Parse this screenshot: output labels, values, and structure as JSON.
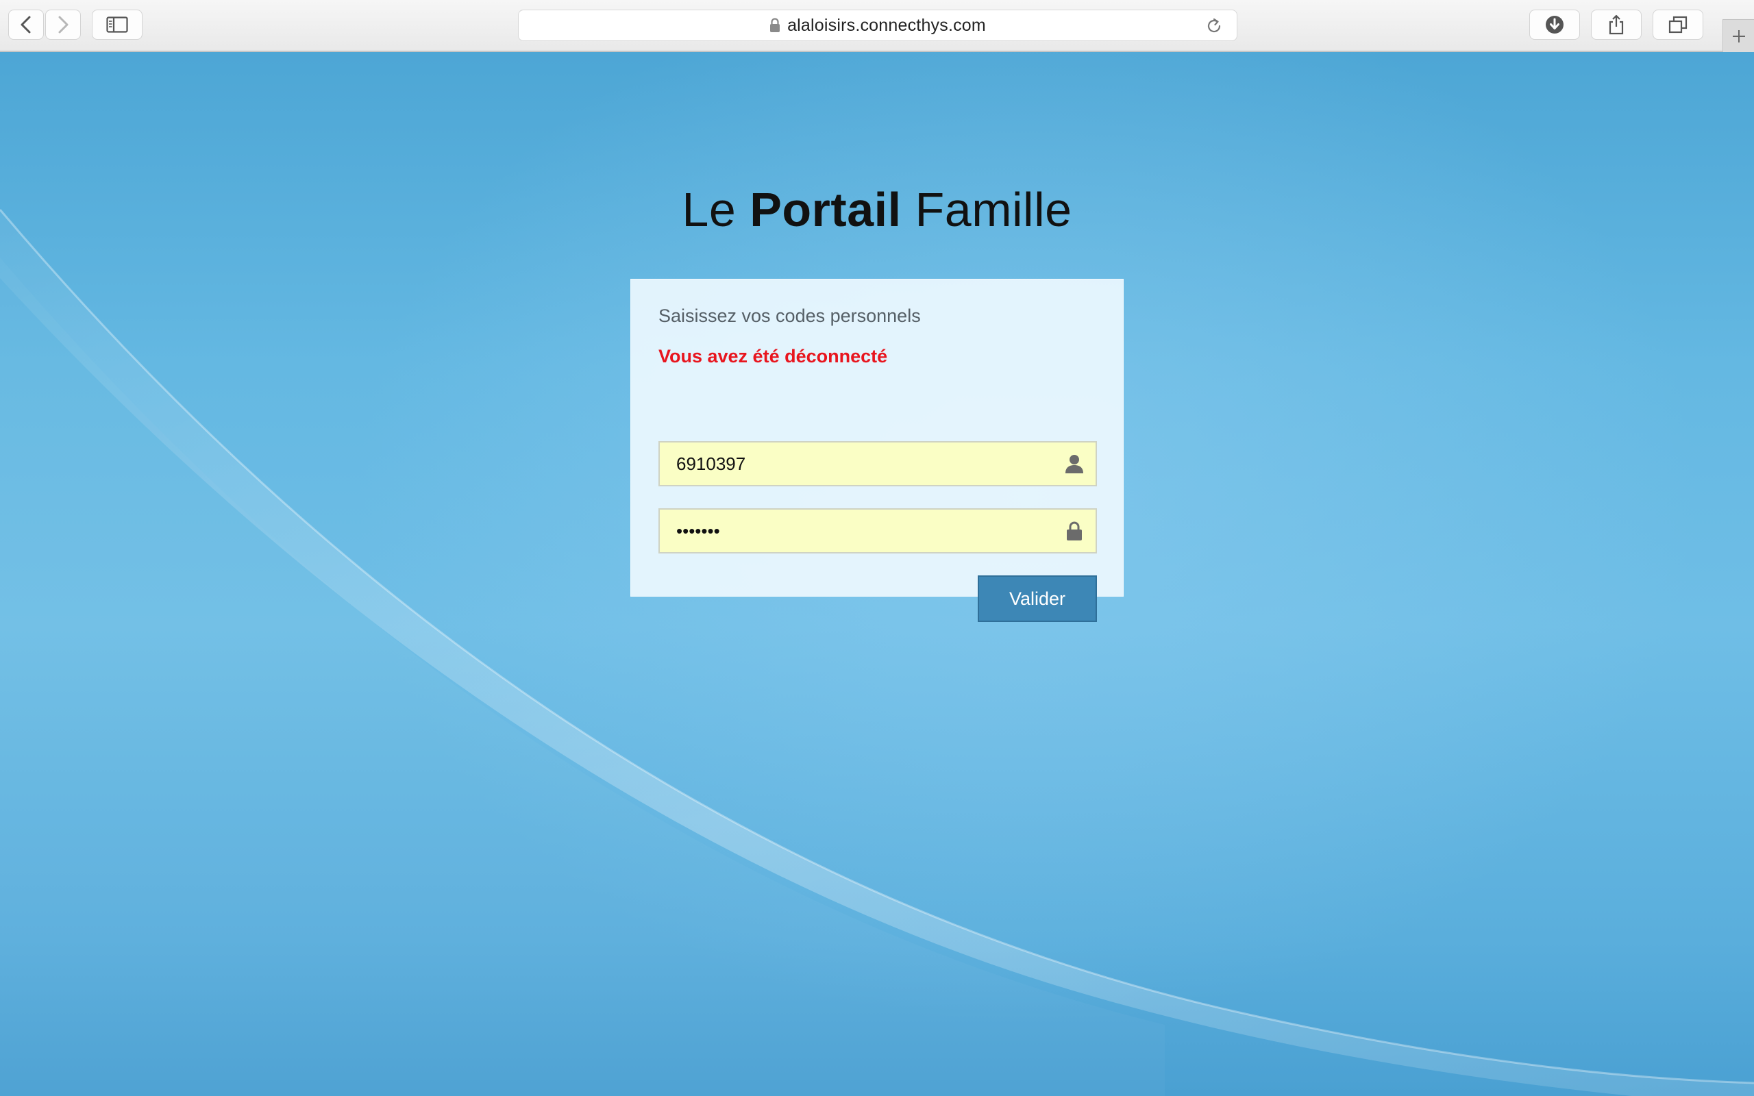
{
  "browser": {
    "url": "alaloisirs.connecthys.com",
    "icons": {
      "back": "chevron-left-icon",
      "forward": "chevron-right-icon",
      "sidebar": "sidebar-icon",
      "lock": "lock-icon",
      "reload": "reload-icon",
      "downloads": "download-icon",
      "share": "share-icon",
      "tabs": "tabs-overview-icon",
      "new_tab": "plus-icon"
    }
  },
  "page": {
    "title_prefix": "Le",
    "title_strong": "Portail",
    "title_suffix": "Famille",
    "login": {
      "subtitle": "Saisissez vos codes personnels",
      "error": "Vous avez été déconnecté",
      "username_value": "6910397",
      "password_value": "•••••••",
      "submit_label": "Valider"
    }
  },
  "colors": {
    "error": "#e8151e",
    "field_background": "#fafec5",
    "button": "#3d87b6",
    "page_background": "#5aaedc"
  }
}
